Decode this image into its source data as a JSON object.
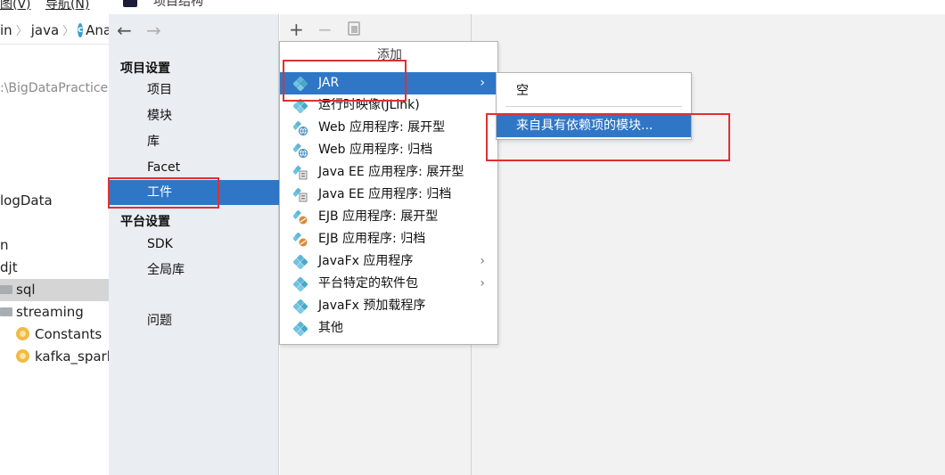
{
  "background_ide": {
    "menubar": [
      "图(V)",
      "导航(N)"
    ],
    "breadcrumb": [
      "in",
      "java",
      "Ana"
    ],
    "project_path": ":\\BigDataPractice",
    "tree": {
      "item_logdata": "logData",
      "item_n": "n",
      "item_djt": "djt",
      "item_sql": "sql",
      "item_streaming": "streaming",
      "item_constants": "Constants",
      "item_kafka": "kafka_spark"
    }
  },
  "dialog": {
    "title": "项目结构",
    "nav": {
      "back_arrow": "←",
      "forward_arrow": "→",
      "project_settings_header": "项目设置",
      "items": [
        "项目",
        "模块",
        "库",
        "Facet",
        "工件"
      ],
      "selected": "工件",
      "platform_settings_header": "平台设置",
      "platform_items": [
        "SDK",
        "全局库"
      ],
      "problems": "问题"
    },
    "toolbar": {
      "add": "+",
      "remove": "−"
    }
  },
  "add_menu": {
    "title": "添加",
    "items": [
      {
        "label": "JAR",
        "submenu": true,
        "highlighted": true,
        "icon": "diamond-icon"
      },
      {
        "label": "运行时映像(JLink)",
        "icon": "diamond-icon"
      },
      {
        "label": "Web 应用程序: 展开型",
        "icon": "web-app-icon"
      },
      {
        "label": "Web 应用程序: 归档",
        "icon": "web-app-icon"
      },
      {
        "label": "Java EE 应用程序: 展开型",
        "icon": "javaee-icon"
      },
      {
        "label": "Java EE 应用程序: 归档",
        "icon": "javaee-icon"
      },
      {
        "label": "EJB 应用程序: 展开型",
        "icon": "ejb-icon"
      },
      {
        "label": "EJB 应用程序: 归档",
        "icon": "ejb-icon"
      },
      {
        "label": "JavaFx 应用程序",
        "submenu": true,
        "icon": "diamond-icon"
      },
      {
        "label": "平台特定的软件包",
        "submenu": true,
        "icon": "diamond-icon"
      },
      {
        "label": "JavaFx 预加载程序",
        "icon": "diamond-icon"
      },
      {
        "label": "其他",
        "icon": "diamond-icon"
      }
    ],
    "chevron": "›"
  },
  "sub_menu": {
    "items": [
      "空",
      "来自具有依赖项的模块..."
    ],
    "highlighted": "来自具有依赖项的模块..."
  },
  "colors": {
    "selection_blue": "#2f77c6",
    "annotation_red": "#e03030",
    "nav_background": "#eaedf1",
    "diamond_teal": "#5fb7d4"
  }
}
